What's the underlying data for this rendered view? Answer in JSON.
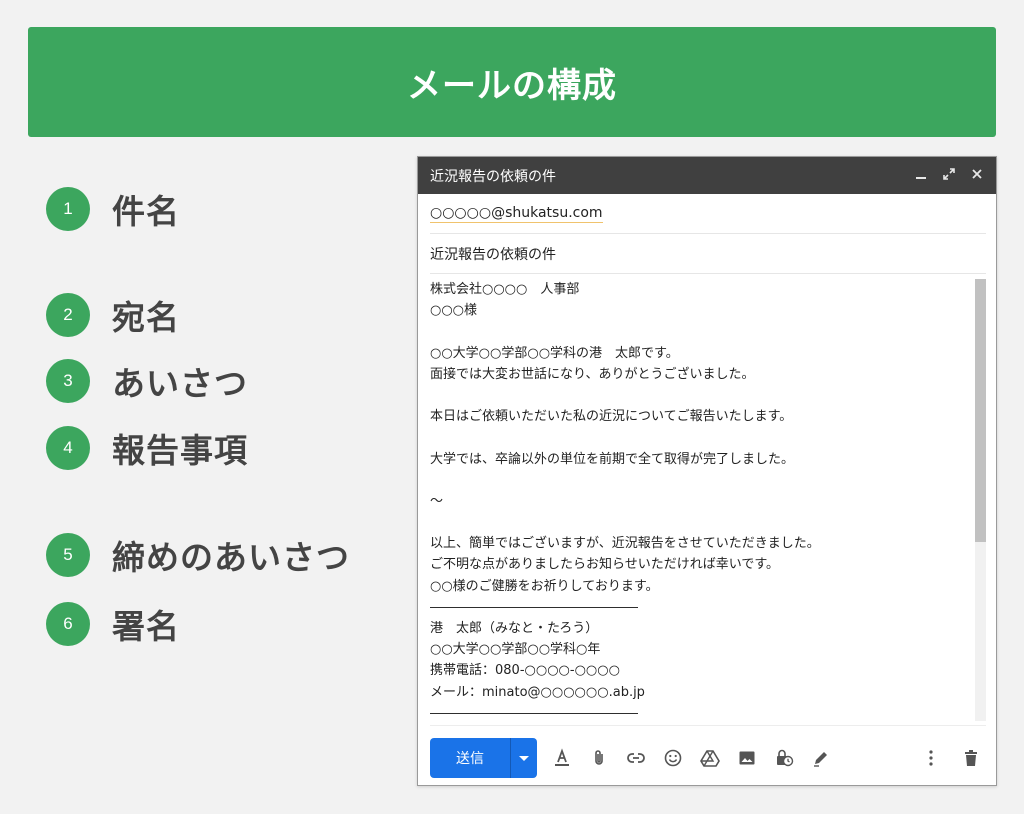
{
  "banner": {
    "title": "メールの構成"
  },
  "legend": [
    {
      "num": "1",
      "label": "件名"
    },
    {
      "num": "2",
      "label": "宛名"
    },
    {
      "num": "3",
      "label": "あいさつ"
    },
    {
      "num": "4",
      "label": "報告事項"
    },
    {
      "num": "5",
      "label": "締めのあいさつ"
    },
    {
      "num": "6",
      "label": "署名"
    }
  ],
  "compose": {
    "window_title": "近況報告の依頼の件",
    "to": "○○○○○@shukatsu.com",
    "subject": "近況報告の依頼の件",
    "body_lines": [
      "株式会社○○○○　人事部",
      "○○○様",
      "",
      "○○大学○○学部○○学科の港　太郎です。",
      "面接では大変お世話になり、ありがとうございました。",
      "",
      "本日はご依頼いただいた私の近況についてご報告いたします。",
      "",
      "大学では、卒論以外の単位を前期で全て取得が完了しました。",
      "",
      "〜",
      "",
      "以上、簡単ではございますが、近況報告をさせていただきました。",
      "ご不明な点がありましたらお知らせいただければ幸いです。",
      "○○様のご健勝をお祈りしております。",
      "――――――――――――――――",
      "港　太郎（みなと・たろう）",
      " ○○大学○○学部○○学科○年",
      "携帯電話：080-○○○○-○○○○",
      "メール：minato@○○○○○○.ab.jp",
      "――――――――――――――――"
    ],
    "send_label": "送信"
  }
}
